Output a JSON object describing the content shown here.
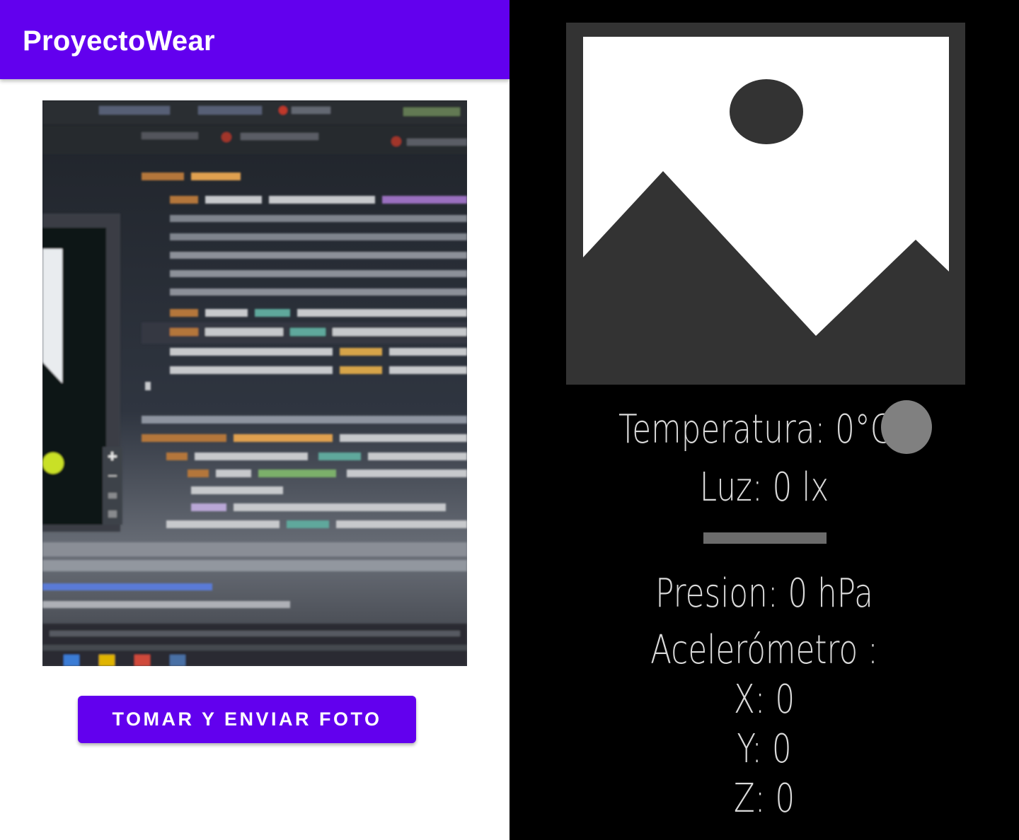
{
  "phone": {
    "app_title": "ProyectoWear",
    "send_button_label": "TOMAR Y ENVIAR FOTO",
    "colors": {
      "primary": "#6200ee",
      "on_primary": "#ffffff"
    }
  },
  "watch": {
    "placeholder_icon": "image-placeholder-icon",
    "temperature": "Temperatura: 0°C",
    "light": "Luz: 0 lx",
    "pressure": "Presion: 0 hPa",
    "accelerometer_title": "Acelerómetro :",
    "accel_x": "X: 0",
    "accel_y": "Y: 0",
    "accel_z": "Z: 0",
    "colors": {
      "background": "#000000",
      "text": "#d9d9d9",
      "status_dot": "#808080"
    }
  }
}
